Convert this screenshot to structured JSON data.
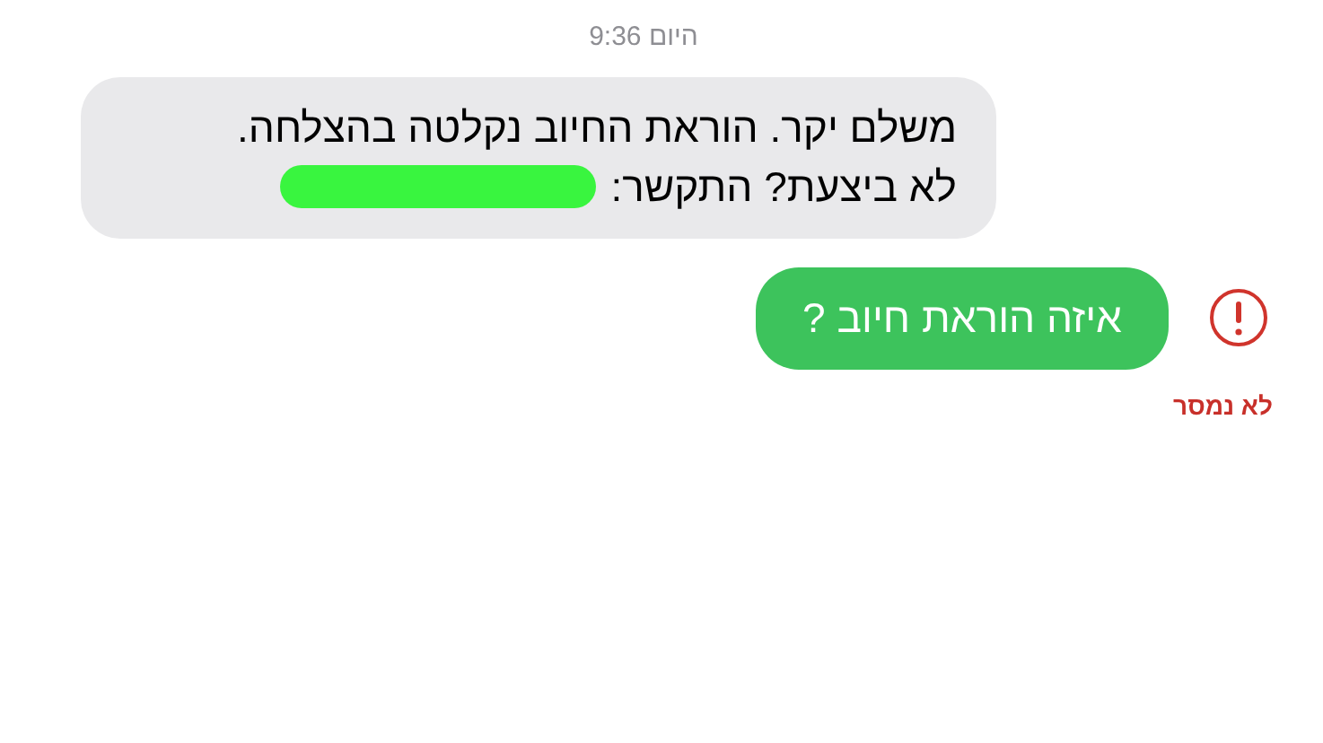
{
  "timestamp": {
    "day": "היום",
    "time": "9:36"
  },
  "messages": [
    {
      "kind": "incoming",
      "lines": [
        "משלם יקר. הוראת החיוב נקלטה בהצלחה.",
        "לא ביצעת? התקשר:"
      ],
      "redacted": true
    },
    {
      "kind": "outgoing",
      "lines": [
        "איזה הוראת חיוב ?"
      ],
      "failed": true,
      "status": "לא נמסר"
    }
  ]
}
